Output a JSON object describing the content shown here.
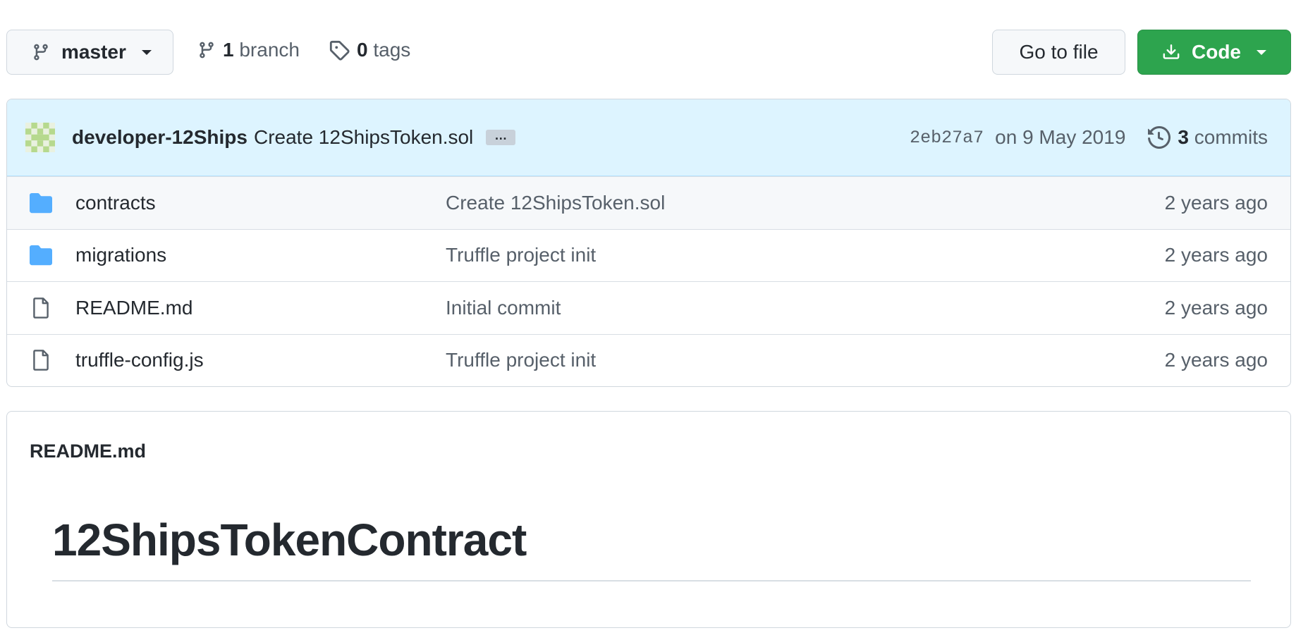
{
  "toolbar": {
    "branch_label": "master",
    "branch_count": "1",
    "branch_word": "branch",
    "tag_count": "0",
    "tag_word": "tags",
    "go_to_file": "Go to file",
    "code": "Code"
  },
  "latest_commit": {
    "author": "developer-12Ships",
    "message": "Create 12ShipsToken.sol",
    "ellipsis": "…",
    "sha": "2eb27a7",
    "date": "on 9 May 2019",
    "commit_count": "3",
    "commit_word": "commits"
  },
  "files": [
    {
      "type": "folder",
      "name": "contracts",
      "commit": "Create 12ShipsToken.sol",
      "age": "2 years ago"
    },
    {
      "type": "folder",
      "name": "migrations",
      "commit": "Truffle project init",
      "age": "2 years ago"
    },
    {
      "type": "file",
      "name": "README.md",
      "commit": "Initial commit",
      "age": "2 years ago"
    },
    {
      "type": "file",
      "name": "truffle-config.js",
      "commit": "Truffle project init",
      "age": "2 years ago"
    }
  ],
  "readme": {
    "filename": "README.md",
    "heading": "12ShipsTokenContract"
  },
  "colors": {
    "accent_green": "#2da44e",
    "commit_bar_bg": "#ddf4ff",
    "folder_blue": "#54aeff"
  },
  "icons": {
    "branch": "git-branch-icon",
    "tag": "tag-icon",
    "download": "download-icon",
    "history": "history-icon",
    "folder": "folder-icon",
    "file": "file-icon"
  }
}
